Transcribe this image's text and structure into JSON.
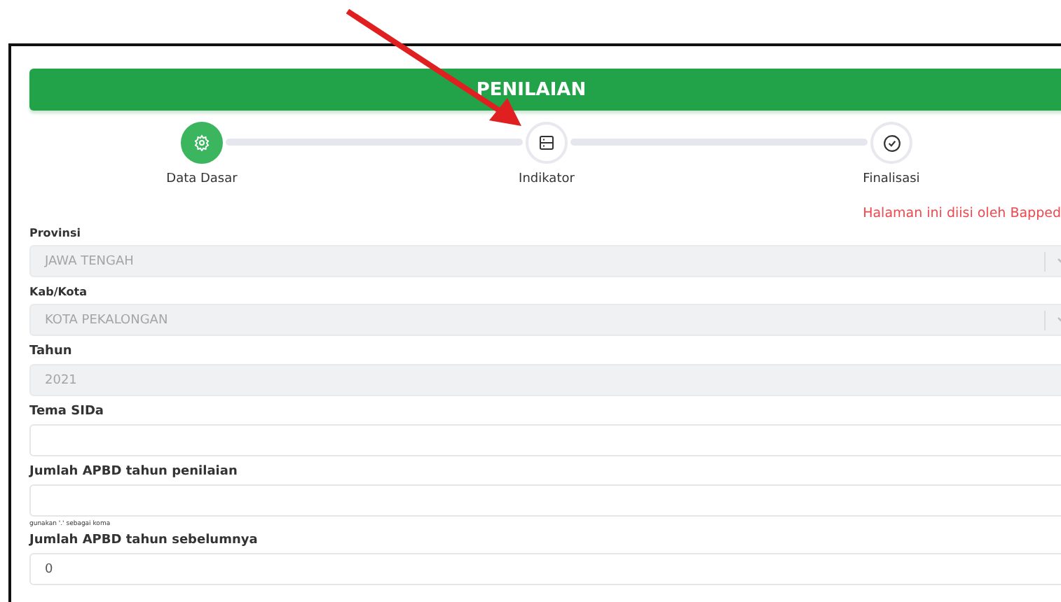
{
  "header": {
    "title": "PENILAIAN"
  },
  "steps": [
    {
      "label": "Data Dasar",
      "kind": "gear",
      "done": true
    },
    {
      "label": "Indikator",
      "kind": "server",
      "done": false
    },
    {
      "label": "Finalisasi",
      "kind": "check",
      "done": false
    }
  ],
  "note": "Halaman ini diisi oleh Bapped",
  "fields": [
    {
      "label": "Provinsi",
      "kind": "select",
      "disabled": true,
      "value": "JAWA TENGAH"
    },
    {
      "label": "Kab/Kota",
      "kind": "select",
      "disabled": true,
      "value": "KOTA PEKALONGAN"
    },
    {
      "label": "Tahun",
      "kind": "input",
      "disabled": true,
      "value": "2021"
    },
    {
      "label": "Tema SIDa",
      "kind": "input",
      "disabled": false
    },
    {
      "label": "Jumlah APBD tahun penilaian",
      "kind": "input",
      "disabled": false,
      "hint": "gunakan '.' sebagai koma"
    },
    {
      "label": "Jumlah APBD tahun sebelumnya",
      "kind": "input",
      "disabled": false,
      "value": "0"
    }
  ]
}
